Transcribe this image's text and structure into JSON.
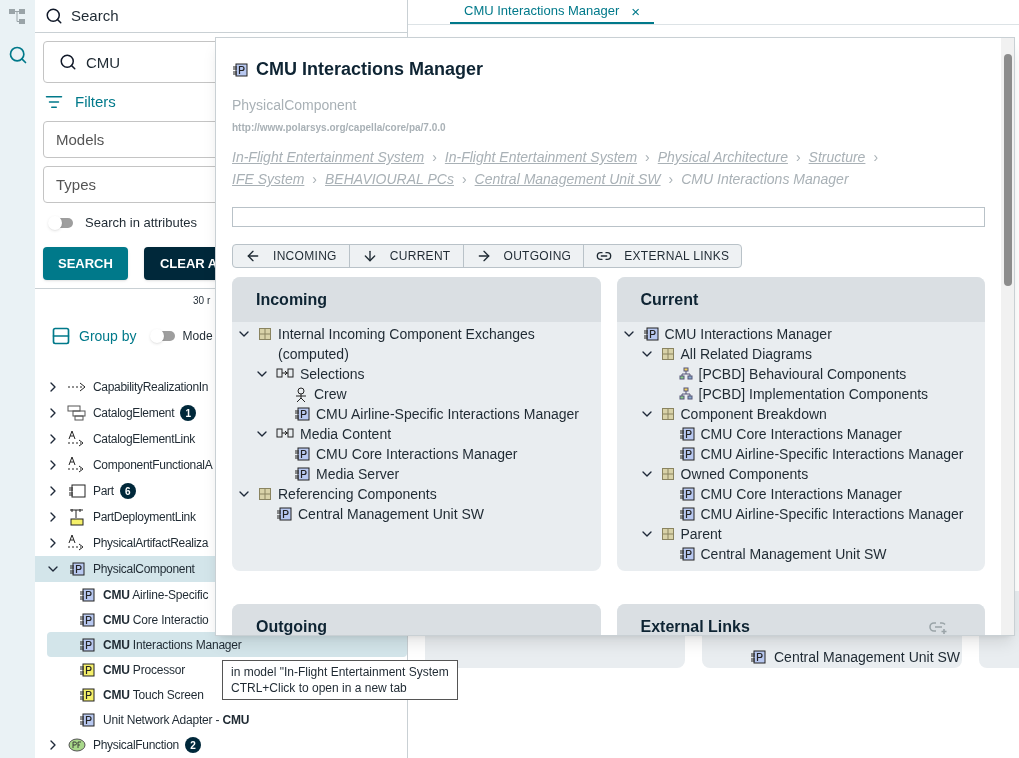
{
  "rail": {
    "items": [
      {
        "kind": "tree",
        "selected": false
      },
      {
        "kind": "search",
        "selected": true
      }
    ]
  },
  "search_panel": {
    "title": "Search",
    "query": "CMU",
    "filters_label": "Filters",
    "models_placeholder": "Models",
    "types_placeholder": "Types",
    "attributes_toggle": {
      "label": "Search in attributes",
      "on": false
    },
    "search_button": "SEARCH",
    "clear_button": "CLEAR A",
    "result_count": "30 r",
    "group_by": {
      "label": "Group by",
      "on": false,
      "option": "Mode"
    },
    "results": [
      {
        "kind": "realization",
        "label": "CapabilityRealizationIn",
        "expanded": false,
        "selected": false
      },
      {
        "kind": "catalog",
        "label": "CatalogElement",
        "count": "1",
        "expanded": false,
        "selected": false
      },
      {
        "kind": "link",
        "label": "CatalogElementLink",
        "expanded": false,
        "selected": false
      },
      {
        "kind": "link",
        "label": "ComponentFunctionalA",
        "expanded": false,
        "selected": false
      },
      {
        "kind": "part",
        "label": "Part",
        "count": "6",
        "expanded": false,
        "selected": false
      },
      {
        "kind": "deployment",
        "label": "PartDeploymentLink",
        "expanded": false,
        "selected": false
      },
      {
        "kind": "link",
        "label": "PhysicalArtifactRealiza",
        "expanded": false,
        "selected": false
      },
      {
        "kind": "component",
        "label": "PhysicalComponent",
        "expanded": true,
        "selected": true,
        "children": [
          {
            "label": "**CMU** Airline-Specific",
            "color": "#b8c8f0",
            "selected": false
          },
          {
            "label": "**CMU** Core Interactio",
            "color": "#b8c8f0",
            "selected": false
          },
          {
            "label": "**CMU** Interactions Manager",
            "color": "#b8c8f0",
            "selected": true
          },
          {
            "label": "**CMU** Processor",
            "color": "#f5f06a",
            "selected": false
          },
          {
            "label": "**CMU** Touch Screen",
            "color": "#f5f06a",
            "selected": false
          },
          {
            "label": "Unit Network Adapter - **CMU**",
            "color": "#b8c8f0",
            "selected": false
          }
        ]
      },
      {
        "kind": "function",
        "label": "PhysicalFunction",
        "count": "2",
        "expanded": false,
        "selected": false
      }
    ]
  },
  "tabs": [
    {
      "label": "CMU Interactions Manager",
      "close": "×",
      "selected": true
    }
  ],
  "background_card": {
    "rows": [
      {
        "kind": "component",
        "label": "Central Management Unit SW"
      }
    ]
  },
  "popup": {
    "title": "CMU Interactions Manager",
    "separator": "›",
    "type": "PhysicalComponent",
    "uri": "http://www.polarsys.org/capella/core/pa/7.0.0",
    "breadcrumbs": [
      {
        "label": "In-Flight Entertainment System",
        "link": true
      },
      {
        "label": "In-Flight Entertainment System",
        "link": true
      },
      {
        "label": "Physical Architecture",
        "link": true
      },
      {
        "label": "Structure",
        "link": true
      },
      {
        "label": "IFE System",
        "link": true
      },
      {
        "label": "BEHAVIOURAL PCs",
        "link": true
      },
      {
        "label": "Central Management Unit SW",
        "link": true
      },
      {
        "label": "CMU Interactions Manager",
        "link": false
      }
    ],
    "buttons": [
      {
        "kind": "left",
        "label": "INCOMING"
      },
      {
        "kind": "down",
        "label": "CURRENT"
      },
      {
        "kind": "right",
        "label": "OUTGOING"
      },
      {
        "kind": "link",
        "label": "EXTERNAL LINKS"
      }
    ],
    "cards": [
      {
        "title": "Incoming",
        "tree": [
          {
            "kind": "folder",
            "label": "Internal Incoming Component Exchanges (computed)",
            "expanded": true,
            "children": [
              {
                "kind": "exchange",
                "label": "Selections",
                "expanded": true,
                "children": [
                  {
                    "kind": "actor",
                    "label": "Crew"
                  },
                  {
                    "kind": "component",
                    "label": "CMU Airline-Specific Interactions Manager"
                  }
                ]
              },
              {
                "kind": "exchange",
                "label": "Media Content",
                "expanded": true,
                "children": [
                  {
                    "kind": "component",
                    "label": "CMU Core Interactions Manager"
                  },
                  {
                    "kind": "component",
                    "label": "Media Server"
                  }
                ]
              }
            ]
          },
          {
            "kind": "folder",
            "label": "Referencing Components",
            "expanded": true,
            "children": [
              {
                "kind": "component",
                "label": "Central Management Unit SW"
              }
            ]
          }
        ]
      },
      {
        "title": "Current",
        "tree": [
          {
            "kind": "component",
            "label": "CMU Interactions Manager",
            "expanded": true,
            "children": [
              {
                "kind": "folder",
                "label": "All Related Diagrams",
                "expanded": true,
                "children": [
                  {
                    "kind": "diagram",
                    "label": "[PCBD] Behavioural Components"
                  },
                  {
                    "kind": "diagram",
                    "label": "[PCBD] Implementation Components"
                  }
                ]
              },
              {
                "kind": "folder",
                "label": "Component Breakdown",
                "expanded": true,
                "children": [
                  {
                    "kind": "component",
                    "label": "CMU Core Interactions Manager"
                  },
                  {
                    "kind": "component",
                    "label": "CMU Airline-Specific Interactions Manager"
                  }
                ]
              },
              {
                "kind": "folder",
                "label": "Owned Components",
                "expanded": true,
                "children": [
                  {
                    "kind": "component",
                    "label": "CMU Core Interactions Manager"
                  },
                  {
                    "kind": "component",
                    "label": "CMU Airline-Specific Interactions Manager"
                  }
                ]
              },
              {
                "kind": "folder",
                "label": "Parent",
                "expanded": true,
                "children": [
                  {
                    "kind": "component",
                    "label": "Central Management Unit SW"
                  }
                ]
              }
            ]
          }
        ]
      },
      {
        "title": "Outgoing"
      },
      {
        "title": "External Links",
        "add_link": true
      }
    ]
  },
  "tooltip": {
    "lines": [
      "in model \"In-Flight Entertainment System",
      "CTRL+Click to open in a new tab"
    ]
  }
}
